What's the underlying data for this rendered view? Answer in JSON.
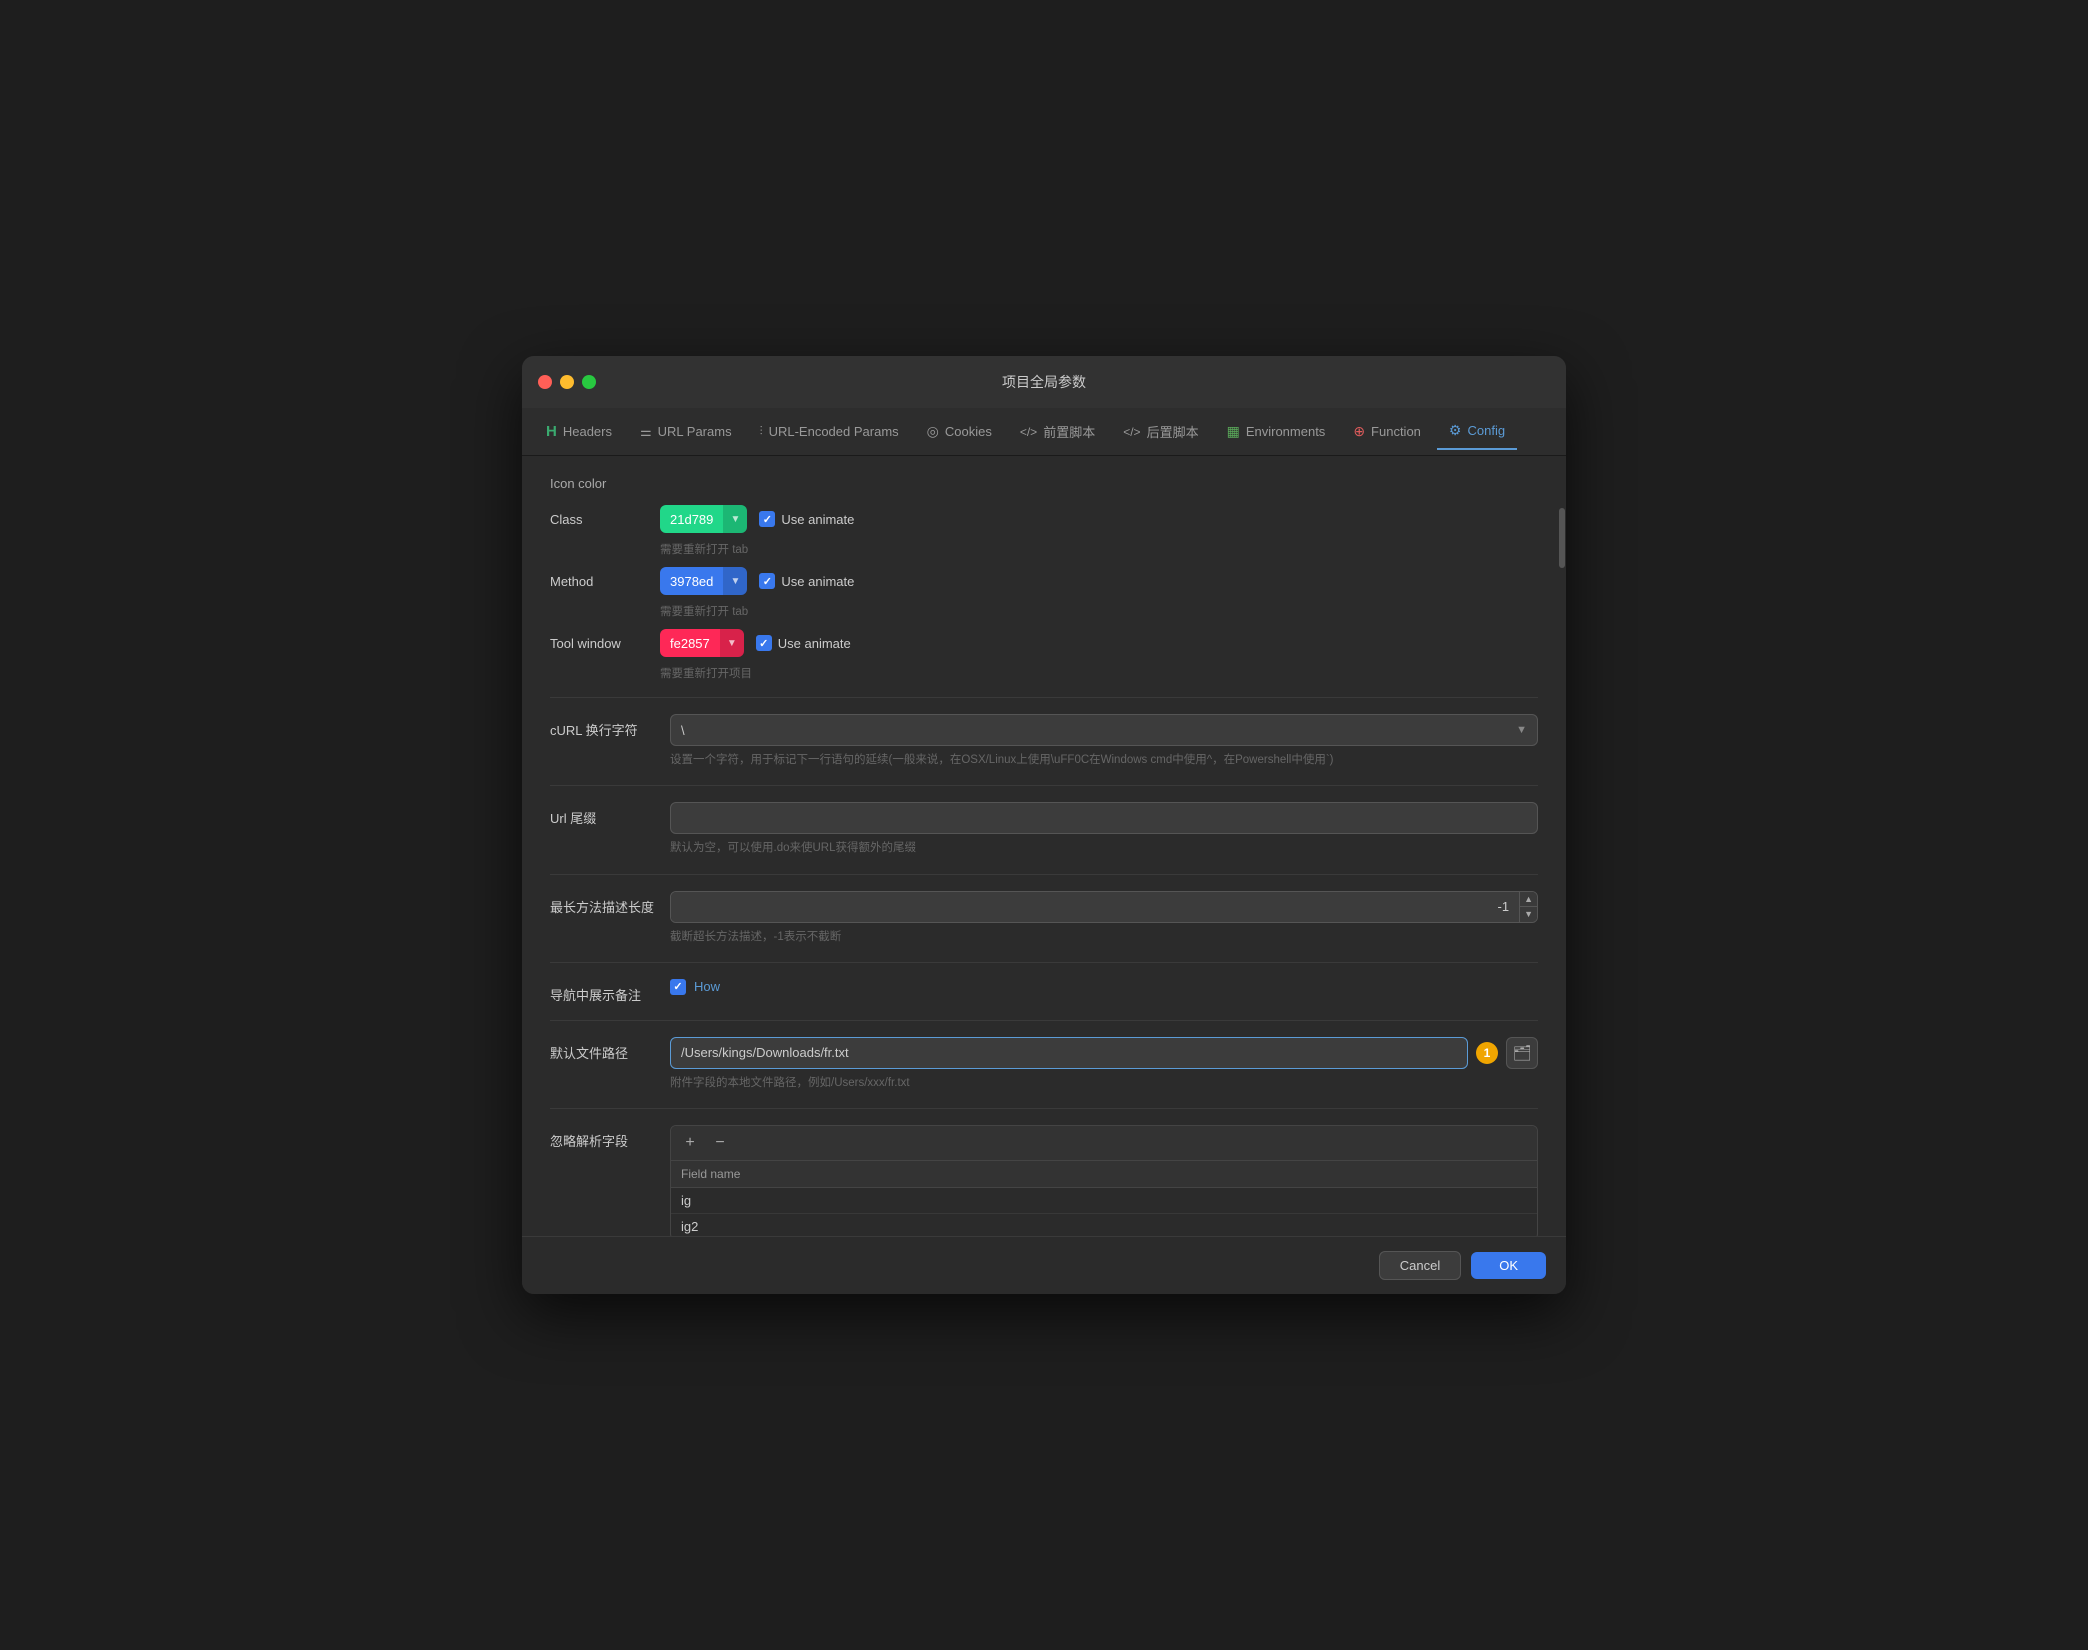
{
  "window": {
    "title": "项目全局参数"
  },
  "tabs": [
    {
      "id": "headers",
      "label": "Headers",
      "icon": "H",
      "icon_color": "#3aaa6f",
      "active": false
    },
    {
      "id": "url-params",
      "label": "URL Params",
      "icon": "≡",
      "icon_color": "#aaa",
      "active": false
    },
    {
      "id": "url-encoded",
      "label": "URL-Encoded Params",
      "icon": "|||",
      "icon_color": "#aaa",
      "active": false
    },
    {
      "id": "cookies",
      "label": "Cookies",
      "icon": "◎",
      "icon_color": "#aaa",
      "active": false
    },
    {
      "id": "pre-script",
      "label": "前置脚本",
      "icon": "</>",
      "icon_color": "#aaa",
      "active": false
    },
    {
      "id": "post-script",
      "label": "后置脚本",
      "icon": "</>",
      "icon_color": "#aaa",
      "active": false
    },
    {
      "id": "environments",
      "label": "Environments",
      "icon": "▦",
      "icon_color": "#aaa",
      "active": false
    },
    {
      "id": "function",
      "label": "Function",
      "icon": "⊕",
      "icon_color": "#e05c5c",
      "active": false
    },
    {
      "id": "config",
      "label": "Config",
      "icon": "⚙",
      "icon_color": "#aaa",
      "active": true
    }
  ],
  "icon_color": {
    "section_title": "Icon color",
    "class_label": "Class",
    "class_value": "21d789",
    "class_color": "#21d789",
    "class_animate": "Use animate",
    "class_hint": "需要重新打开 tab",
    "method_label": "Method",
    "method_value": "3978ed",
    "method_color": "#3978ed",
    "method_animate": "Use animate",
    "method_hint": "需要重新打开 tab",
    "tool_window_label": "Tool window",
    "tool_window_value": "fe2857",
    "tool_window_color": "#fe2857",
    "tool_window_animate": "Use animate",
    "tool_window_hint": "需要重新打开项目"
  },
  "curl_section": {
    "label": "cURL 换行字符",
    "value": "\\",
    "hint": "设置一个字符，用于标记下一行语句的延续(一般来说，在OSX/Linux上使用\\uFF0C在Windows cmd中使用^，在Powershell中使用`)"
  },
  "url_suffix": {
    "label": "Url 尾缀",
    "value": "",
    "placeholder": "",
    "hint": "默认为空，可以使用.do来使URL获得额外的尾缀"
  },
  "max_method_length": {
    "label": "最长方法描述长度",
    "value": "-1",
    "hint": "截断超长方法描述，-1表示不截断"
  },
  "show_note": {
    "label": "导航中展示备注",
    "checked": true,
    "how_label": "How"
  },
  "default_file_path": {
    "label": "默认文件路径",
    "value": "/Users/kings/Downloads/fr.txt",
    "badge": "1",
    "hint": "附件字段的本地文件路径，例如/Users/xxx/fr.txt"
  },
  "ignore_fields": {
    "label": "忽略解析字段",
    "add_btn": "+",
    "remove_btn": "−",
    "column_header": "Field name",
    "rows": [
      "ig",
      "ig2"
    ]
  },
  "footer": {
    "cancel_label": "Cancel",
    "ok_label": "OK"
  }
}
